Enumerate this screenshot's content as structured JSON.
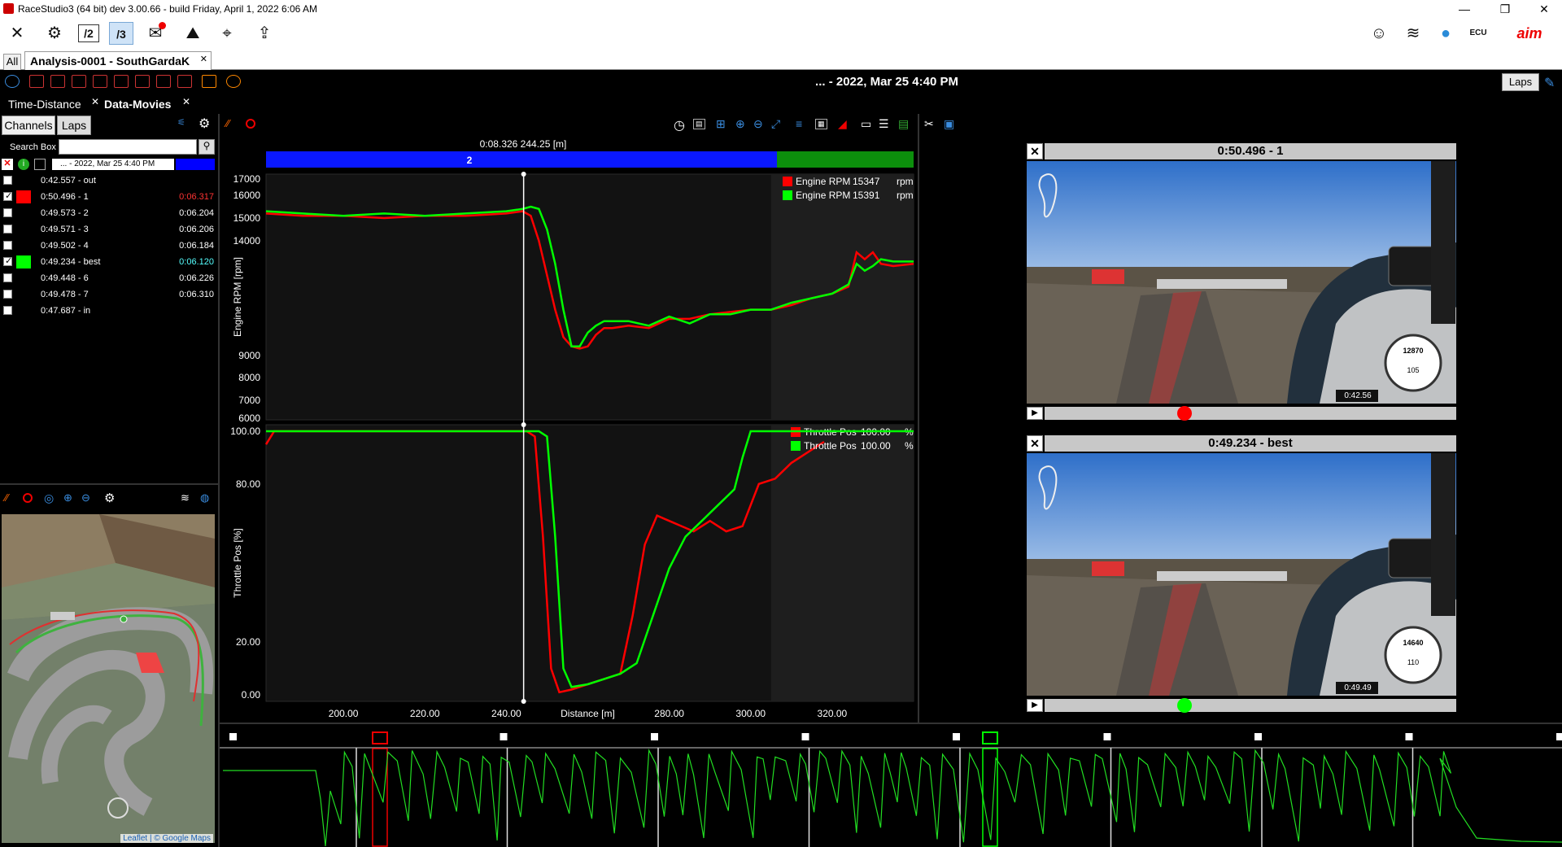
{
  "window": {
    "title": "RaceStudio3 (64 bit) dev 3.00.66 - build Friday, April 1, 2022 6:06 AM",
    "controls": [
      "—",
      "❐",
      "✕"
    ]
  },
  "toolbar": {
    "icons": [
      "tools-icon",
      "settings-gear-icon",
      "analysis-v2-icon",
      "analysis-v3-icon",
      "notifications-icon",
      "track-icon",
      "location-icon",
      "share-icon"
    ],
    "right_icons": [
      "user-avatar-icon",
      "wifi-icon",
      "globe-icon",
      "ecu-icon",
      "aim-logo"
    ],
    "ecu_label": "ECU",
    "logo_label": "aim"
  },
  "tabs": {
    "all_label": "All",
    "analysis_label": "Analysis-0001 - SouthGardaK",
    "analysis_close": "✕"
  },
  "header": {
    "date_title": "... - 2022, Mar 25 4:40 PM",
    "laps_button": "Laps"
  },
  "subtabs": {
    "time_distance": "Time-Distance",
    "data_movies": "Data-Movies"
  },
  "left_panel": {
    "channels_button": "Channels",
    "laps_button": "Laps",
    "search_label": "Search Box",
    "search_value": "",
    "session_row": "... - 2022, Mar 25 4:40 PM",
    "laps": [
      {
        "name": "0:42.557 - out",
        "value": "",
        "checked": false,
        "color": ""
      },
      {
        "name": "0:50.496 - 1",
        "value": "0:06.317",
        "checked": true,
        "color": "#ff0000"
      },
      {
        "name": "0:49.573 - 2",
        "value": "0:06.204",
        "checked": false,
        "color": ""
      },
      {
        "name": "0:49.571 - 3",
        "value": "0:06.206",
        "checked": false,
        "color": ""
      },
      {
        "name": "0:49.502 - 4",
        "value": "0:06.184",
        "checked": false,
        "color": ""
      },
      {
        "name": "0:49.234 - best",
        "value": "0:06.120",
        "checked": true,
        "color": "#00ff00"
      },
      {
        "name": "0:49.448 - 6",
        "value": "0:06.226",
        "checked": false,
        "color": ""
      },
      {
        "name": "0:49.478 - 7",
        "value": "0:06.310",
        "checked": false,
        "color": ""
      },
      {
        "name": "0:47.687 - in",
        "value": "",
        "checked": false,
        "color": ""
      }
    ],
    "map_attribution": "Leaflet | © Google Maps"
  },
  "chart_header": {
    "cursor_readout": "0:08.326  244.25 [m]",
    "segment_label": "2"
  },
  "chart_data": [
    {
      "type": "line",
      "title": "",
      "ylabel": "Engine RPM [rpm]",
      "xlabel": "Distance [m]",
      "xlim": [
        181,
        340
      ],
      "ylim": [
        6000,
        17000
      ],
      "yticks": [
        "17000",
        "16000",
        "15000",
        "14000",
        "9000",
        "8000",
        "7000",
        "6000"
      ],
      "xticks": [
        "200.00",
        "220.00",
        "240.00",
        "280.00",
        "300.00",
        "320.00"
      ],
      "series": [
        {
          "name": "Engine RPM",
          "legend_value": "15347",
          "unit": "rpm",
          "color": "#ff0000",
          "x": [
            181,
            190,
            200,
            210,
            220,
            230,
            240,
            244,
            246,
            248,
            250,
            252,
            254,
            256,
            258,
            260,
            262,
            264,
            266,
            270,
            275,
            280,
            285,
            290,
            295,
            300,
            305,
            310,
            315,
            320,
            324,
            326,
            328,
            330,
            332,
            335,
            340
          ],
          "y": [
            15200,
            15100,
            15100,
            15000,
            15100,
            15100,
            15200,
            15300,
            15100,
            14000,
            12500,
            11000,
            9800,
            9400,
            9300,
            9400,
            9900,
            10200,
            10200,
            10300,
            10200,
            10600,
            10600,
            10800,
            10900,
            11000,
            11000,
            11200,
            11500,
            11700,
            12000,
            13500,
            13200,
            13500,
            13000,
            12900,
            13000
          ]
        },
        {
          "name": "Engine RPM",
          "legend_value": "15391",
          "unit": "rpm",
          "color": "#00ff00",
          "x": [
            181,
            190,
            200,
            210,
            220,
            230,
            240,
            244,
            246,
            248,
            250,
            252,
            254,
            256,
            258,
            260,
            262,
            264,
            266,
            270,
            275,
            280,
            285,
            290,
            295,
            300,
            305,
            310,
            315,
            320,
            324,
            326,
            328,
            330,
            332,
            335,
            340
          ],
          "y": [
            15300,
            15200,
            15100,
            15200,
            15100,
            15200,
            15300,
            15400,
            15500,
            15400,
            14500,
            13000,
            11000,
            9400,
            9400,
            10000,
            10300,
            10500,
            10500,
            10500,
            10300,
            10700,
            10400,
            10800,
            10800,
            11000,
            11000,
            11300,
            11500,
            11700,
            12100,
            13000,
            12700,
            12900,
            13200,
            13100,
            13100
          ]
        }
      ]
    },
    {
      "type": "line",
      "title": "",
      "ylabel": "Throttle Pos [%]",
      "xlabel": "Distance [m]",
      "xlim": [
        181,
        340
      ],
      "ylim": [
        0,
        100
      ],
      "yticks": [
        "100.00",
        "80.00",
        "20.00",
        "0.00"
      ],
      "xticks": [
        "200.00",
        "220.00",
        "240.00",
        "280.00",
        "300.00",
        "320.00"
      ],
      "series": [
        {
          "name": "Throttle Pos",
          "legend_value": "100.00",
          "unit": "%",
          "color": "#ff0000",
          "x": [
            181,
            183,
            185,
            200,
            220,
            240,
            245,
            247,
            249,
            251,
            253,
            256,
            260,
            264,
            268,
            271,
            274,
            277,
            280,
            283,
            286,
            290,
            294,
            298,
            302,
            306,
            310,
            314,
            318
          ],
          "y": [
            95,
            100,
            100,
            100,
            100,
            100,
            100,
            98,
            60,
            10,
            1,
            2,
            4,
            6,
            8,
            30,
            57,
            68,
            66,
            64,
            62,
            66,
            62,
            64,
            80,
            82,
            88,
            92,
            96
          ]
        },
        {
          "name": "Throttle Pos",
          "legend_value": "100.00",
          "unit": "%",
          "color": "#00ff00",
          "x": [
            181,
            200,
            220,
            240,
            248,
            250,
            252,
            254,
            256,
            260,
            264,
            268,
            272,
            276,
            280,
            284,
            288,
            292,
            296,
            298,
            300,
            302,
            340
          ],
          "y": [
            100,
            100,
            100,
            100,
            100,
            98,
            60,
            10,
            3,
            4,
            6,
            8,
            12,
            30,
            48,
            60,
            66,
            72,
            78,
            90,
            100,
            100,
            100
          ]
        }
      ]
    }
  ],
  "videos": [
    {
      "title": "0:50.496 - 1",
      "close": "✕",
      "dial_top": "12870",
      "dial_bottom": "105",
      "time_overlay": "0:42.56",
      "marker_color": "#ff0000",
      "progress": 0.34
    },
    {
      "title": "0:49.234 - best",
      "close": "✕",
      "dial_top": "14640",
      "dial_bottom": "110",
      "time_overlay": "0:49.49",
      "marker_color": "#00ff00",
      "progress": 0.34
    }
  ],
  "bottom_strip": {
    "lap_markers": 9,
    "selected_laps": [
      1,
      5
    ]
  }
}
